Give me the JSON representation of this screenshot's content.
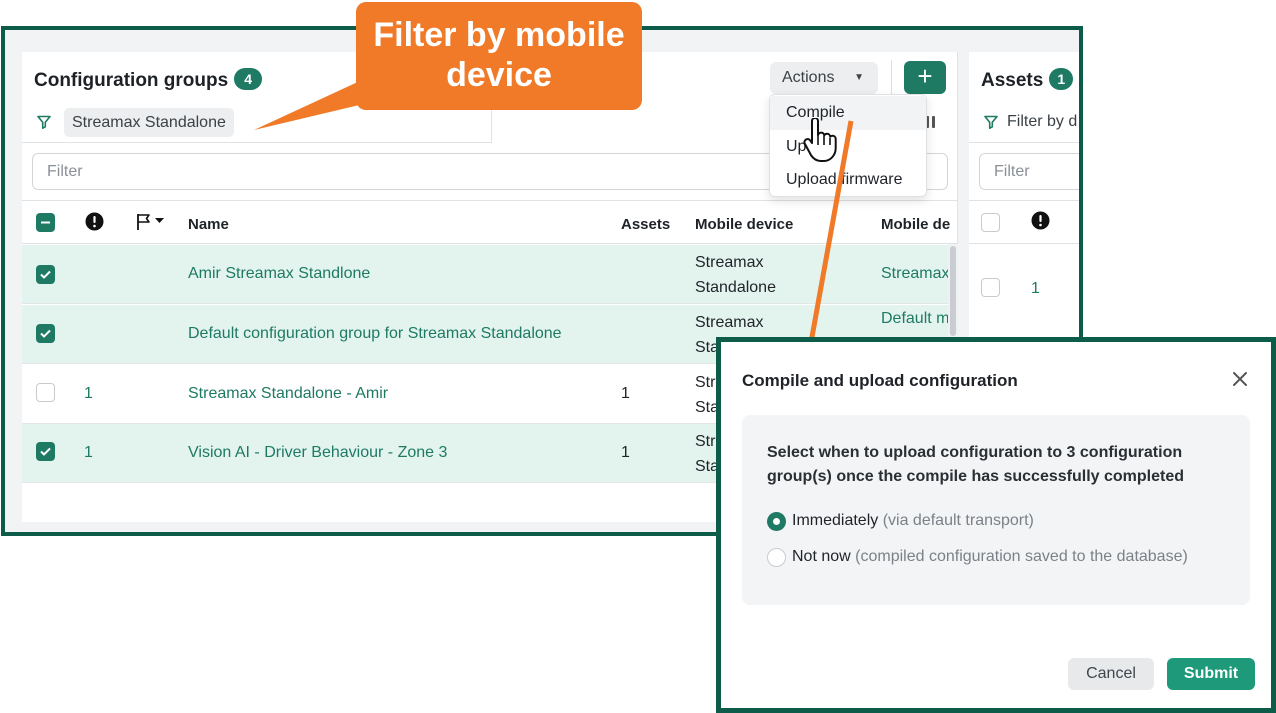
{
  "callout": {
    "line1": "Filter by mobile",
    "line2": "device"
  },
  "config_panel": {
    "title": "Configuration groups",
    "count": "4",
    "actions_label": "Actions",
    "add_label": "+",
    "filter_chip": "Streamax Standalone",
    "filter_placeholder": "Filter",
    "columns": {
      "name": "Name",
      "assets": "Assets",
      "mobile_device": "Mobile device",
      "mobile_device_2": "Mobile de"
    },
    "rows": [
      {
        "selected": true,
        "count": "",
        "name": "Amir Streamax Standlone",
        "assets": "",
        "md_line1": "Streamax",
        "md_line2": "Standalone",
        "md2": "Streamax"
      },
      {
        "selected": true,
        "count": "",
        "name": "Default configuration group for Streamax Standalone",
        "assets": "",
        "md_line1": "Streamax",
        "md_line2": "Sta",
        "md2": "Default m"
      },
      {
        "selected": false,
        "count": "1",
        "name": "Streamax Standalone - Amir",
        "assets": "1",
        "md_line1": "Stre",
        "md_line2": "Sta",
        "md2": ""
      },
      {
        "selected": true,
        "count": "1",
        "name": "Vision AI - Driver Behaviour - Zone 3",
        "assets": "1",
        "md_line1": "Stre",
        "md_line2": "Sta",
        "md2": ""
      }
    ]
  },
  "actions_menu": {
    "items": [
      "Compile",
      "Upload",
      "Upload firmware"
    ]
  },
  "assets_panel": {
    "title": "Assets",
    "count": "1",
    "filter_chip": "Filter by d",
    "filter_placeholder": "Filter",
    "row_count": "1"
  },
  "modal": {
    "title": "Compile and upload configuration",
    "message": "Select when to upload configuration to 3 configuration group(s) once the compile has successfully completed",
    "options": [
      {
        "label": "Immediately",
        "hint": "(via default transport)",
        "selected": true
      },
      {
        "label": "Not now",
        "hint": "(compiled configuration saved to the database)",
        "selected": false
      }
    ],
    "cancel_label": "Cancel",
    "submit_label": "Submit"
  },
  "colors": {
    "accent": "#1e7a62",
    "frame": "#0d5c4a",
    "callout": "#f07a28",
    "selected_row": "#e3f4ef"
  }
}
